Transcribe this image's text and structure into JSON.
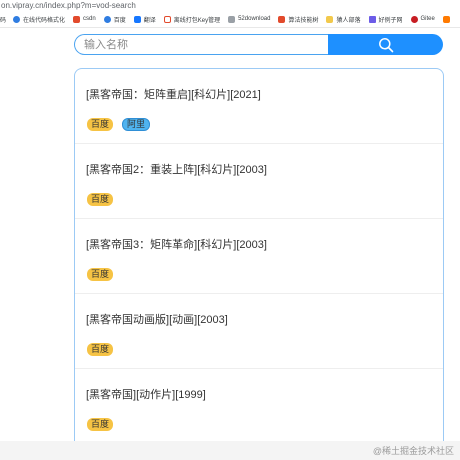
{
  "browser": {
    "url": "on.vipray.cn/index.php?m=vod-search",
    "bookmarks": [
      {
        "label": "码",
        "icon": "none",
        "color": "#ffffff"
      },
      {
        "label": "在线代码格式化",
        "icon": "edge-icon",
        "color": "#2f7de1"
      },
      {
        "label": "csdn",
        "icon": "csdn-icon",
        "color": "#e24a2c"
      },
      {
        "label": "百度",
        "icon": "baidu-icon",
        "color": "#2f7de1"
      },
      {
        "label": "翻译",
        "icon": "translate-icon",
        "color": "#1677ff"
      },
      {
        "label": "离线打包Key管理",
        "icon": "play-icon",
        "color": "#e24a2c"
      },
      {
        "label": "52download",
        "icon": "download-icon",
        "color": "#9aa0a6"
      },
      {
        "label": "算法技能树",
        "icon": "csdn-icon",
        "color": "#e24a2c"
      },
      {
        "label": "猿人部落",
        "icon": "tribe-icon",
        "color": "#f2c94c"
      },
      {
        "label": "好例子网",
        "icon": "example-icon",
        "color": "#6c5ce7"
      },
      {
        "label": "Gitee",
        "icon": "gitee-icon",
        "color": "#c71d23"
      },
      {
        "label": "",
        "icon": "orange-icon",
        "color": "#ff7a00"
      },
      {
        "label": "",
        "icon": "cyan-icon",
        "color": "#1f9ed8"
      }
    ]
  },
  "search": {
    "placeholder": "输入名称",
    "button_icon": "search-icon",
    "accent": "#1e90ff"
  },
  "results": [
    {
      "title": "[黑客帝国：矩阵重启][科幻片][2021]",
      "tags": [
        "百度",
        "阿里"
      ]
    },
    {
      "title": "[黑客帝国2：重装上阵][科幻片][2003]",
      "tags": [
        "百度"
      ]
    },
    {
      "title": "[黑客帝国3：矩阵革命][科幻片][2003]",
      "tags": [
        "百度"
      ]
    },
    {
      "title": "[黑客帝国动画版][动画][2003]",
      "tags": [
        "百度"
      ]
    },
    {
      "title": "[黑客帝国][动作片][1999]",
      "tags": [
        "百度"
      ]
    }
  ],
  "watermark": "@稀土掘金技术社区"
}
